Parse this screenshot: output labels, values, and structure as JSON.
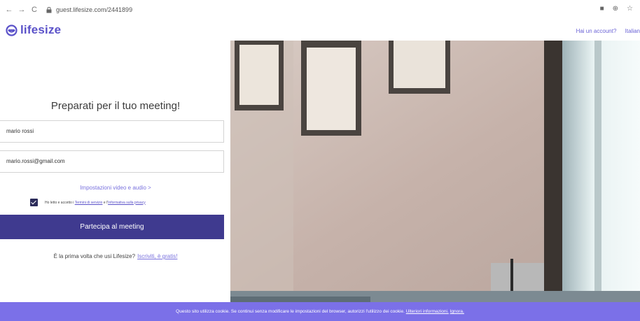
{
  "browser": {
    "back_icon": "back-arrow-icon",
    "forward_icon": "forward-arrow-icon",
    "reload_icon": "reload-icon",
    "url": "guest.lifesize.com/2441899"
  },
  "header": {
    "logo_text": "lifesize",
    "account_link": "Hai un account?",
    "language": "Italian"
  },
  "form": {
    "title": "Preparati per il tuo meeting!",
    "name_value": "mario rossi",
    "email_value": "mario.rossi@gmail.com",
    "settings_link": "Impostazioni video e audio >",
    "consent_prefix": "Ho letto e accetto i ",
    "terms_link": "Termini di servizio",
    "consent_middle": " e l'",
    "privacy_link": "Informativa sulla privacy",
    "consent_checked": true,
    "join_button": "Partecipa al meeting",
    "first_time_text": "È la prima volta che usi Lifesize?",
    "signup_link": "Iscriviti, è gratis!"
  },
  "cookie_bar": {
    "message": "Questo sito utilizza cookie. Se continui senza modificare le impostazioni del browser, autorizzi l'utilizzo dei cookie. ",
    "more_info": "Ulteriori informazioni.",
    "ignore": "Ignora."
  },
  "colors": {
    "brand": "#5b52c9",
    "join_button": "#3f3a8f",
    "cookie_bar": "#7b70e8"
  }
}
